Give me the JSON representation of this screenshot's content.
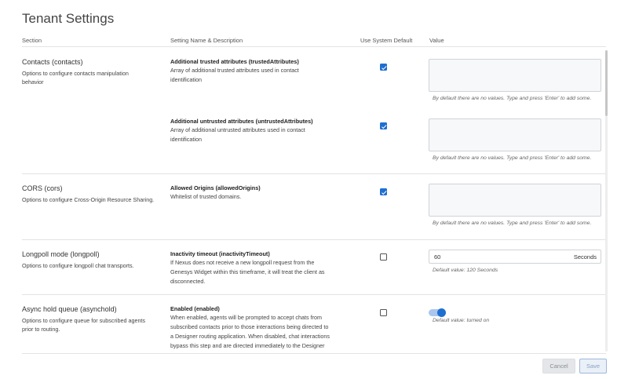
{
  "page": {
    "title": "Tenant Settings"
  },
  "columns": {
    "section": "Section",
    "setting": "Setting Name & Description",
    "use_default": "Use System Default",
    "value": "Value"
  },
  "sections": [
    {
      "title": "Contacts (contacts)",
      "desc": [
        "Options to configure contacts manipulation",
        "behavior"
      ],
      "settings": [
        {
          "name": "Additional trusted attributes (trustedAttributes)",
          "desc": [
            "Array of additional trusted attributes used in contact",
            "identification"
          ],
          "use_default": true,
          "hint": "By default there are no values. Type and press 'Enter' to add some."
        },
        {
          "name": "Additional untrusted attributes (untrustedAttributes)",
          "desc": [
            "Array of additional untrusted attributes used in contact",
            "identification"
          ],
          "use_default": true,
          "hint": "By default there are no values. Type and press 'Enter' to add some."
        }
      ]
    },
    {
      "title": "CORS (cors)",
      "desc": [
        "Options to configure Cross-Origin Resource Sharing."
      ],
      "settings": [
        {
          "name": "Allowed Origins (allowedOrigins)",
          "desc": [
            "Whitelist of trusted domains."
          ],
          "use_default": true,
          "hint": "By default there are no values. Type and press 'Enter' to add some."
        }
      ]
    },
    {
      "title": "Longpoll mode (longpoll)",
      "desc": [
        "Options to configure longpoll chat transports."
      ],
      "settings": [
        {
          "name": "Inactivity timeout (inactivityTimeout)",
          "desc": [
            "If Nexus does not receive a new longpoll request from the",
            "Genesys Widget within this timeframe, it will treat the client as",
            "disconnected."
          ],
          "use_default": false,
          "value": "60",
          "unit": "Seconds",
          "hint": "Default value: 120 Seconds"
        }
      ]
    },
    {
      "title": "Async hold queue (asynchold)",
      "desc": [
        "Options to configure queue for subscribed agents",
        "prior to routing."
      ],
      "settings": [
        {
          "name": "Enabled (enabled)",
          "desc": [
            "When enabled, agents will be prompted to accept chats from",
            "subscribed contacts prior to those interactions being directed to",
            "a Designer routing application. When disabled, chat interactions",
            "bypass this step and are directed immediately to the Designer"
          ],
          "use_default": false,
          "toggle_on": true,
          "hint": "Default value: turned on"
        }
      ]
    }
  ],
  "footer": {
    "cancel_label": "Cancel",
    "save_label": "Save"
  }
}
